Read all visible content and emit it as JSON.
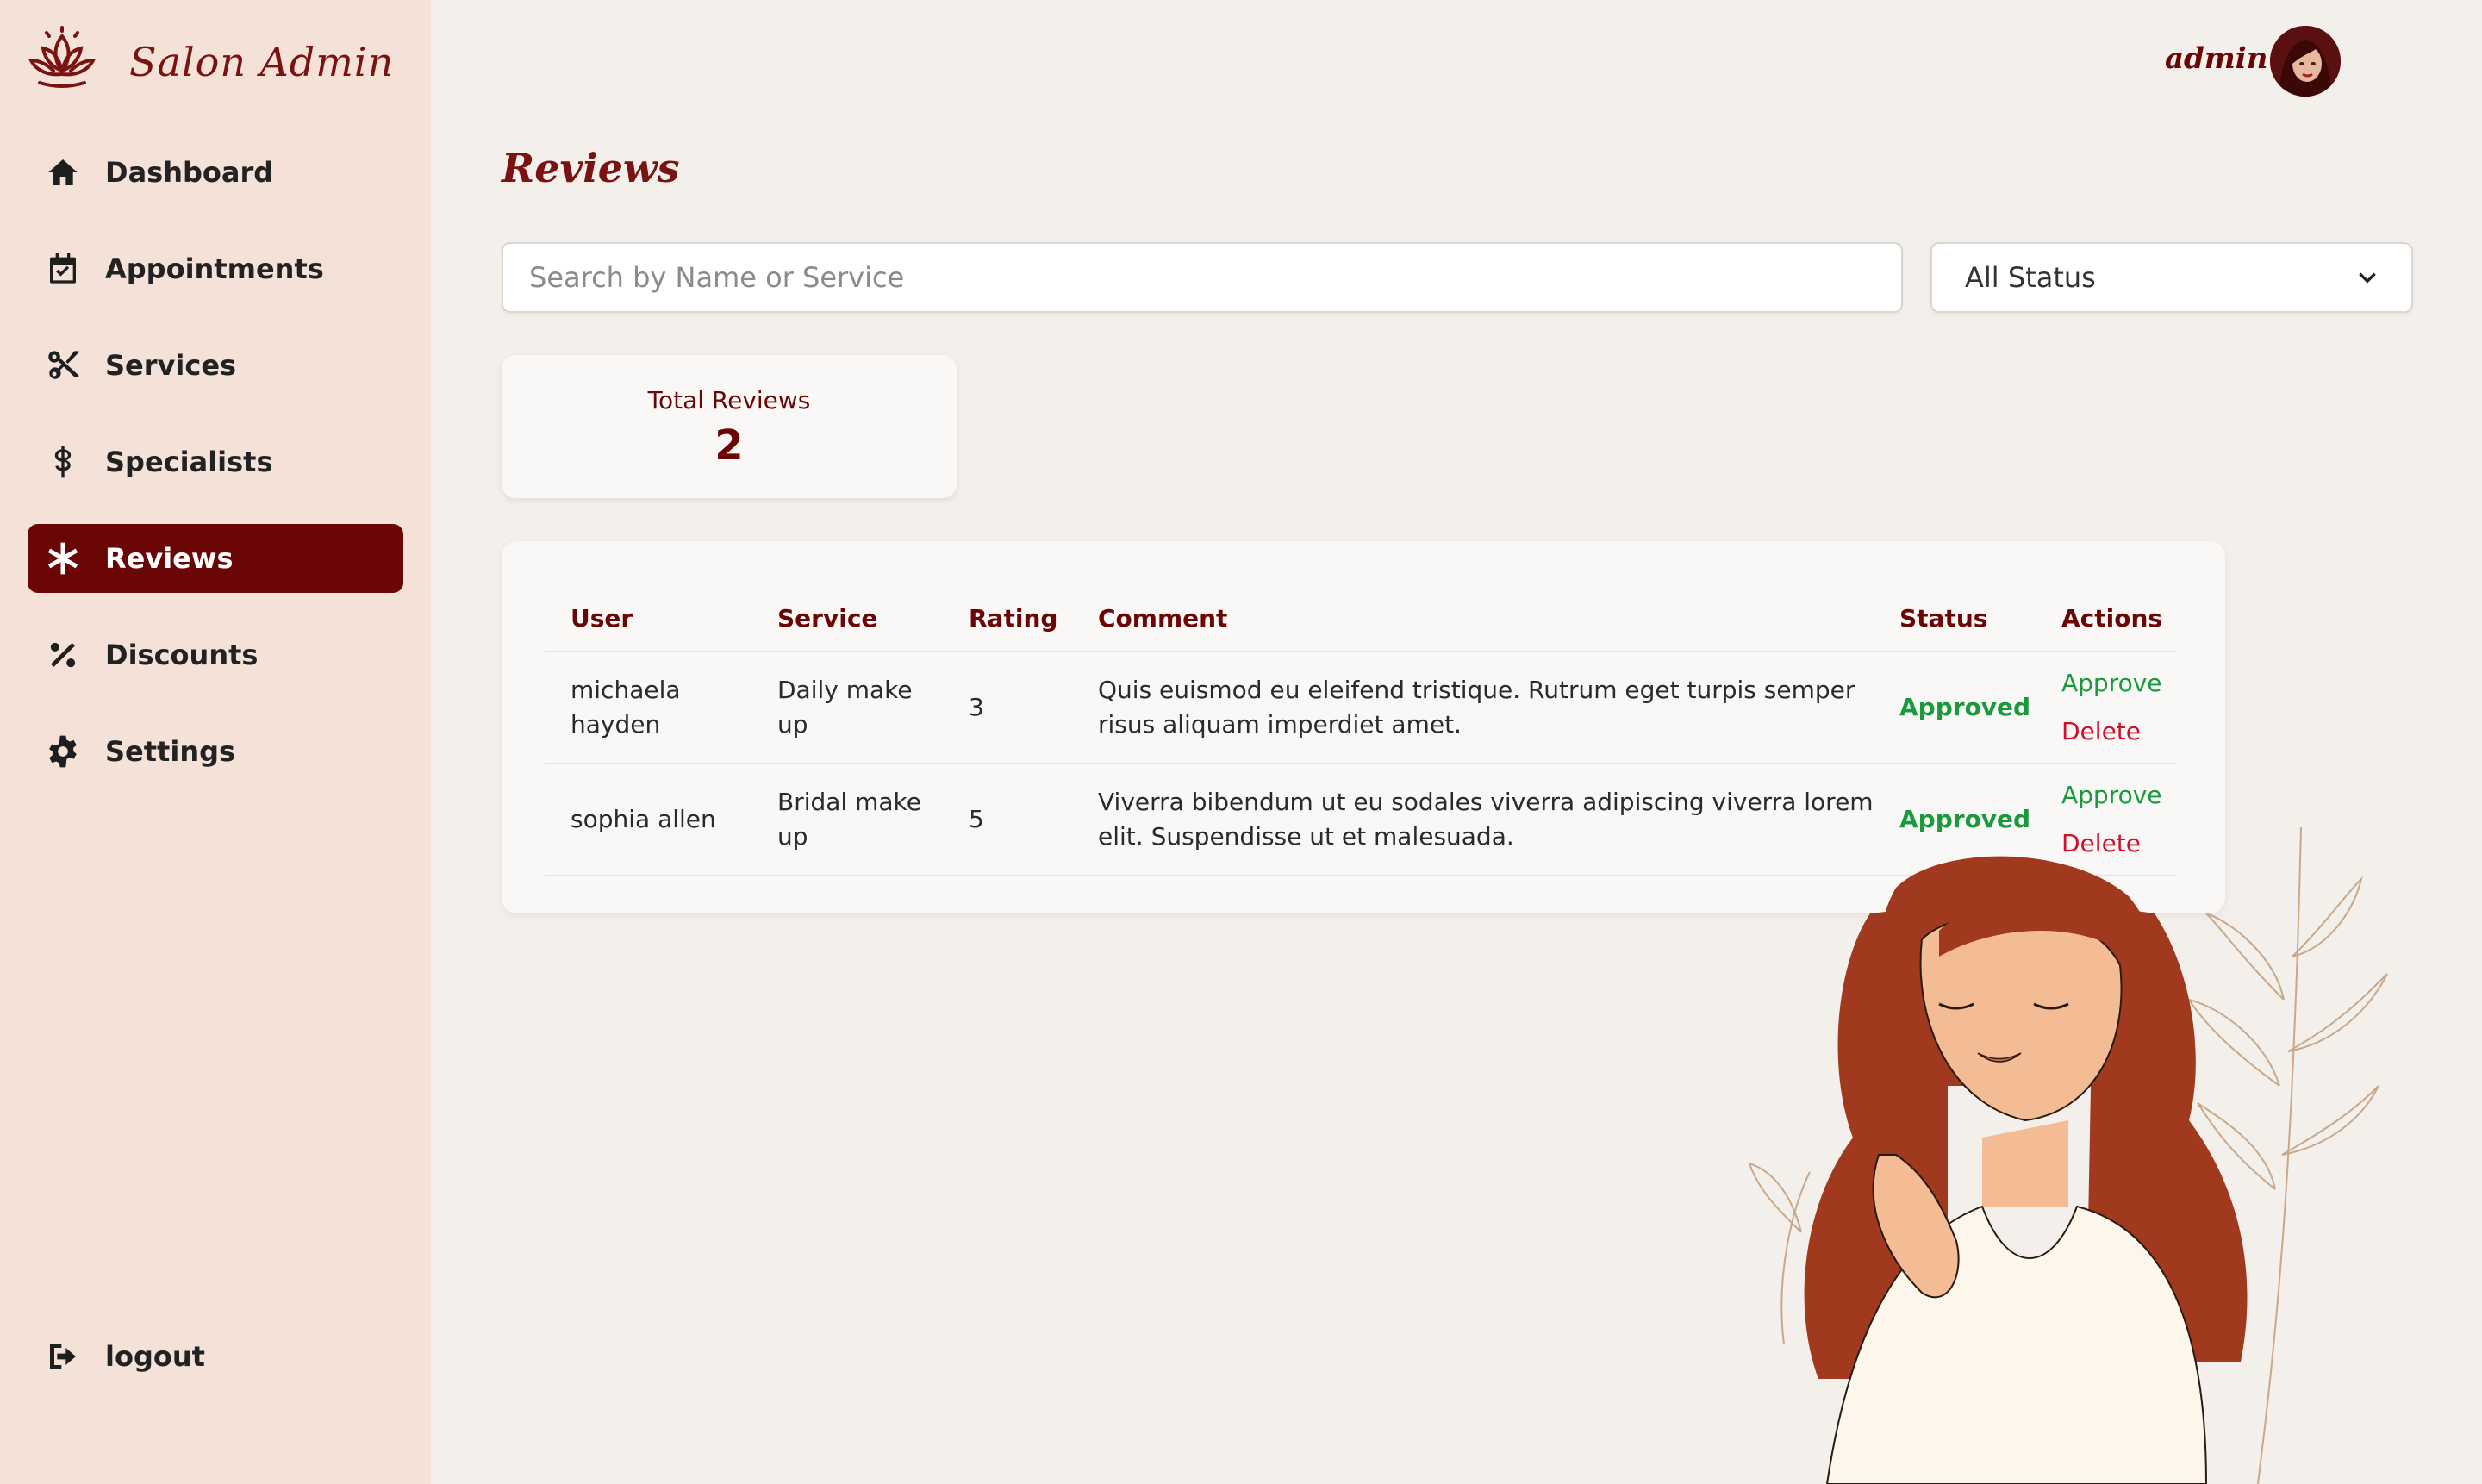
{
  "brand": {
    "name": "Salon Admin"
  },
  "sidebar": {
    "items": [
      {
        "label": "Dashboard",
        "icon": "home-icon",
        "active": false
      },
      {
        "label": "Appointments",
        "icon": "calendar-check-icon",
        "active": false
      },
      {
        "label": "Services",
        "icon": "scissors-icon",
        "active": false
      },
      {
        "label": "Specialists",
        "icon": "staff-of-hermes-icon",
        "active": false
      },
      {
        "label": "Reviews",
        "icon": "asterisk-icon",
        "active": true
      },
      {
        "label": "Discounts",
        "icon": "percent-icon",
        "active": false
      },
      {
        "label": "Settings",
        "icon": "gear-icon",
        "active": false
      }
    ],
    "logout": {
      "label": "logout",
      "icon": "logout-icon"
    }
  },
  "header": {
    "user_name": "admin"
  },
  "page": {
    "title": "Reviews"
  },
  "filters": {
    "search_placeholder": "Search by Name or Service",
    "status_selected": "All Status"
  },
  "stats": {
    "total_label": "Total Reviews",
    "total_value": "2"
  },
  "table": {
    "headers": [
      "User",
      "Service",
      "Rating",
      "Comment",
      "Status",
      "Actions"
    ],
    "rows": [
      {
        "user": "michaela hayden",
        "service": "Daily make up",
        "rating": "3",
        "comment": "Quis euismod eu eleifend tristique. Rutrum eget turpis semper risus aliquam imperdiet amet.",
        "status": "Approved",
        "approve": "Approve",
        "delete": "Delete"
      },
      {
        "user": "sophia allen",
        "service": "Bridal make up",
        "rating": "5",
        "comment": "Viverra bibendum ut eu sodales viverra adipiscing viverra lorem elit. Suspendisse ut et malesuada.",
        "status": "Approved",
        "approve": "Approve",
        "delete": "Delete"
      }
    ]
  },
  "colors": {
    "primary": "#6b0606",
    "sidebar_bg": "#f4e2d8",
    "page_bg": "#f3efea",
    "approved": "#1a9a3c",
    "delete": "#d0102a"
  }
}
